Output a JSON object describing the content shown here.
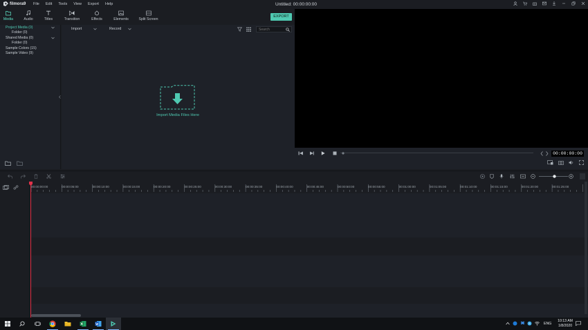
{
  "app": {
    "name": "filmora9",
    "window_title": "Untitled:",
    "window_timecode": "00:00:00:00"
  },
  "menu": [
    "File",
    "Edit",
    "Tools",
    "View",
    "Export",
    "Help"
  ],
  "tabs": [
    {
      "label": "Media",
      "icon": "folder-icon",
      "active": true
    },
    {
      "label": "Audio",
      "icon": "music-note-icon",
      "active": false
    },
    {
      "label": "Titles",
      "icon": "text-icon",
      "active": false
    },
    {
      "label": "Transition",
      "icon": "transition-icon",
      "active": false
    },
    {
      "label": "Effects",
      "icon": "effects-icon",
      "active": false
    },
    {
      "label": "Elements",
      "icon": "image-icon",
      "active": false
    },
    {
      "label": "Split Screen",
      "icon": "split-screen-icon",
      "active": false
    }
  ],
  "export_label": "EXPORT",
  "tree": [
    {
      "label": "Project Media (0)",
      "selected": true
    },
    {
      "label": "Folder (0)",
      "selected": false
    },
    {
      "label": "Shared Media (0)",
      "selected": false
    },
    {
      "label": "Folder (0)",
      "selected": false
    },
    {
      "label": "Sample Colors (15)",
      "selected": false
    },
    {
      "label": "Sample Video (9)",
      "selected": false
    }
  ],
  "library": {
    "import_label": "Import",
    "record_label": "Record",
    "search_placeholder": "Search",
    "drop_label": "Import Media Files Here"
  },
  "preview": {
    "timecode": "00:00:00:00"
  },
  "ruler_labels": [
    "00:00:00:00",
    "00:00:05:00",
    "00:00:10:00",
    "00:00:15:00",
    "00:00:20:00",
    "00:00:25:00",
    "00:00:30:00",
    "00:00:35:00",
    "00:00:40:00",
    "00:00:45:00",
    "00:00:50:00",
    "00:00:55:00",
    "00:01:00:00",
    "00:01:05:00",
    "00:01:10:00",
    "00:01:15:00",
    "00:01:20:00",
    "00:01:25:00"
  ],
  "tracks": {
    "video_number": "1",
    "audio_number": "1"
  },
  "taskbar": {
    "language": "ENG",
    "time": "10:13 AM",
    "date": "1/8/2020"
  },
  "colors": {
    "accent": "#4fc9b1",
    "playhead": "#e2334a",
    "panel": "#1e2128",
    "background": "#1b1d22"
  }
}
